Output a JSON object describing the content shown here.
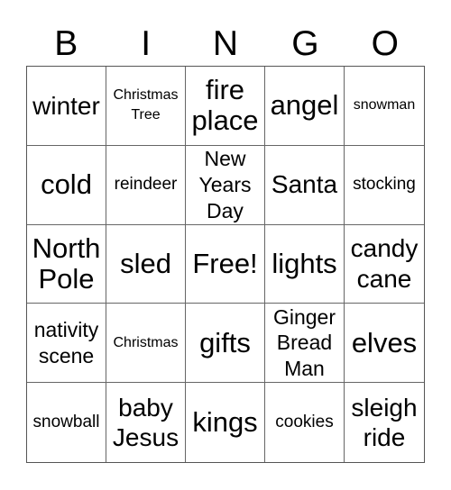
{
  "title_letters": [
    "B",
    "I",
    "N",
    "G",
    "O"
  ],
  "cells": [
    [
      {
        "text": "winter",
        "size": "s-lg"
      },
      {
        "text": "Christmas\nTree",
        "size": "s-xs"
      },
      {
        "text": "fire\nplace",
        "size": "s-xl"
      },
      {
        "text": "angel",
        "size": "s-xl"
      },
      {
        "text": "snowman",
        "size": "s-xs"
      }
    ],
    [
      {
        "text": "cold",
        "size": "s-xl"
      },
      {
        "text": "reindeer",
        "size": "s-sm"
      },
      {
        "text": "New\nYears\nDay",
        "size": "s-md"
      },
      {
        "text": "Santa",
        "size": "s-lg"
      },
      {
        "text": "stocking",
        "size": "s-sm"
      }
    ],
    [
      {
        "text": "North\nPole",
        "size": "s-xl"
      },
      {
        "text": "sled",
        "size": "s-xl"
      },
      {
        "text": "Free!",
        "size": "s-xl"
      },
      {
        "text": "lights",
        "size": "s-xl"
      },
      {
        "text": "candy\ncane",
        "size": "s-lg"
      }
    ],
    [
      {
        "text": "nativity\nscene",
        "size": "s-md"
      },
      {
        "text": "Christmas",
        "size": "s-xs"
      },
      {
        "text": "gifts",
        "size": "s-xl"
      },
      {
        "text": "Ginger\nBread\nMan",
        "size": "s-md"
      },
      {
        "text": "elves",
        "size": "s-xl"
      }
    ],
    [
      {
        "text": "snowball",
        "size": "s-sm"
      },
      {
        "text": "baby\nJesus",
        "size": "s-lg"
      },
      {
        "text": "kings",
        "size": "s-xl"
      },
      {
        "text": "cookies",
        "size": "s-sm"
      },
      {
        "text": "sleigh\nride",
        "size": "s-lg"
      }
    ]
  ],
  "colors": {
    "grid_line": "#666666",
    "text": "#000000",
    "background": "#ffffff"
  }
}
